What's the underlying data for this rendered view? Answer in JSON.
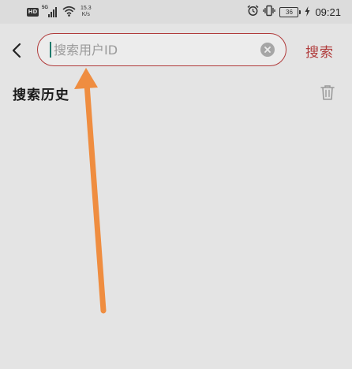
{
  "status_bar": {
    "hd_label": "HD",
    "network_label": "5G",
    "speed_value": "15.3",
    "speed_unit": "K/s",
    "battery_level": "36",
    "time": "09:21"
  },
  "search": {
    "placeholder": "搜索用户ID",
    "value": "",
    "button_label": "搜索"
  },
  "history": {
    "title": "搜索历史",
    "items": []
  },
  "colors": {
    "accent": "#b03a3a",
    "caret": "#1e7a6c",
    "background": "#e4e4e4",
    "annotation_arrow": "#ef8d40"
  },
  "icons": {
    "back": "chevron-left-icon",
    "clear": "clear-circle-icon",
    "delete_history": "trash-icon",
    "annotation": "arrow-up-annotation"
  }
}
